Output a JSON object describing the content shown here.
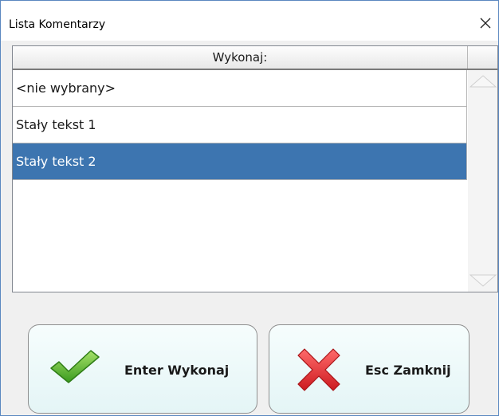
{
  "window": {
    "title": "Lista Komentarzy",
    "close_icon": "close-icon",
    "border_color": "#5a87c0"
  },
  "grid": {
    "column_header": "Wykonaj:",
    "rows": [
      {
        "label": "<nie wybrany>",
        "selected": false
      },
      {
        "label": "Stały tekst 1",
        "selected": false
      },
      {
        "label": "Stały tekst 2",
        "selected": true
      }
    ],
    "selection_color": "#3d75b0",
    "scroll_up_icon": "triangle-up-icon",
    "scroll_down_icon": "triangle-down-icon"
  },
  "buttons": {
    "execute": {
      "label": "Enter Wykonaj",
      "icon": "checkmark-icon",
      "icon_color": "#4caf2a"
    },
    "close": {
      "label": "Esc Zamknij",
      "icon": "red-x-icon",
      "icon_color": "#e2262b"
    }
  }
}
